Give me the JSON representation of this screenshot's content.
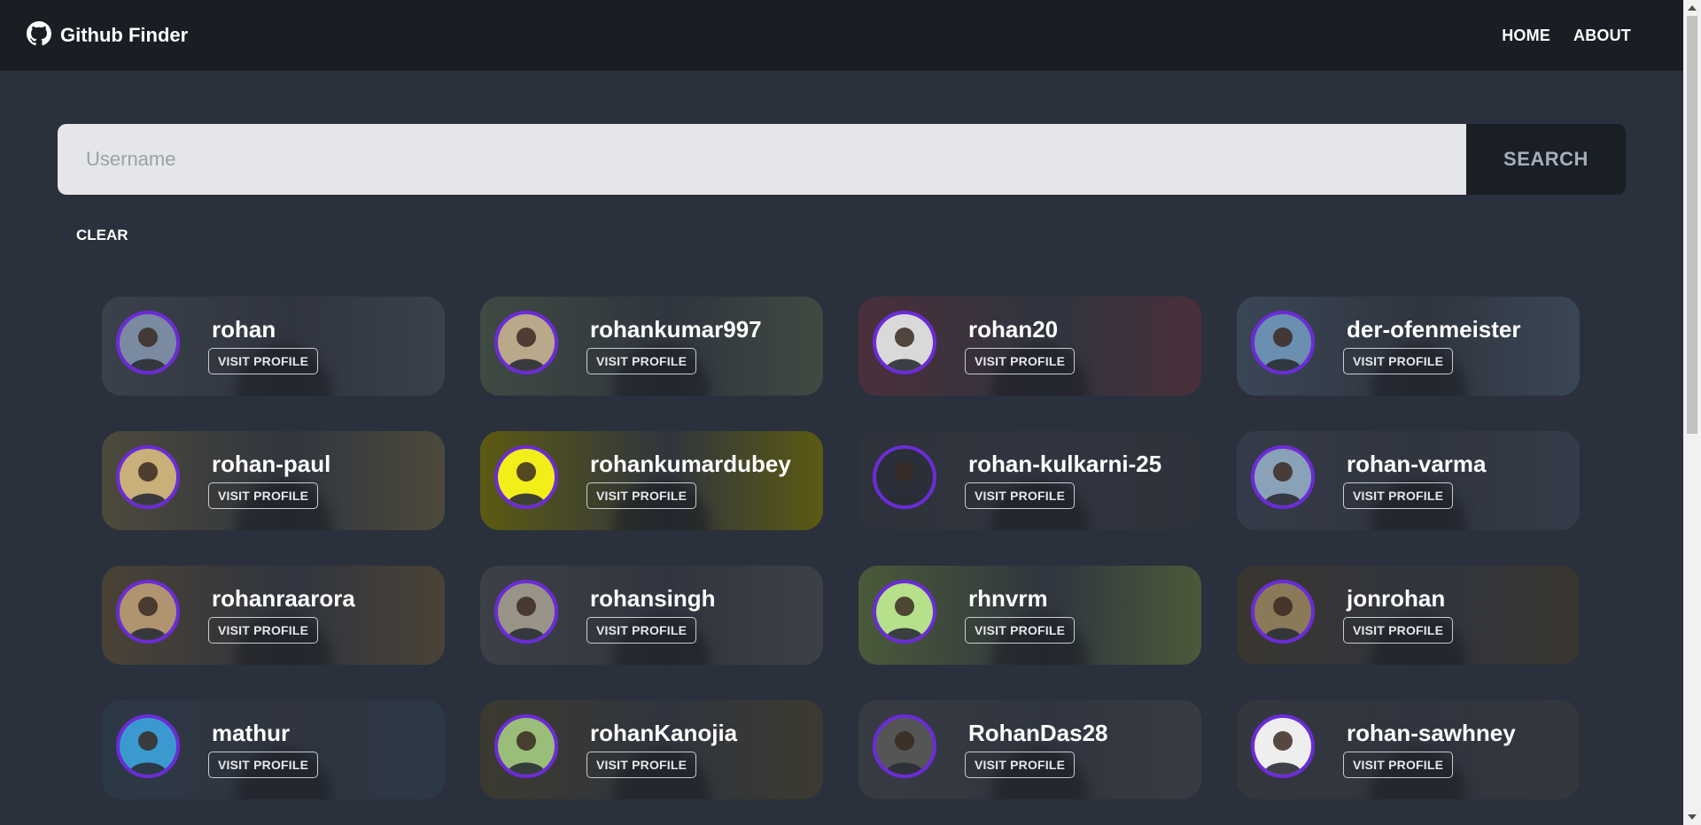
{
  "navbar": {
    "brand_icon": "github-icon",
    "brand_title": "Github Finder",
    "links": [
      "HOME",
      "ABOUT"
    ]
  },
  "search": {
    "placeholder": "Username",
    "button_label": "SEARCH",
    "clear_label": "CLEAR"
  },
  "users": [
    {
      "login": "rohan",
      "action": "VISIT PROFILE",
      "tone": "#3b414c",
      "avatar_bg": "#7a8aa0"
    },
    {
      "login": "rohankumar997",
      "action": "VISIT PROFILE",
      "tone": "#3f4a42",
      "avatar_bg": "#b9a98a"
    },
    {
      "login": "rohan20",
      "action": "VISIT PROFILE",
      "tone": "#4a2f3c",
      "avatar_bg": "#d9d9d9"
    },
    {
      "login": "der-ofenmeister",
      "action": "VISIT PROFILE",
      "tone": "#3a4656",
      "avatar_bg": "#6a8fb0"
    },
    {
      "login": "rohan-paul",
      "action": "VISIT PROFILE",
      "tone": "#4d4a3c",
      "avatar_bg": "#c9b07a"
    },
    {
      "login": "rohankumardubey",
      "action": "VISIT PROFILE",
      "tone": "#5c5a12",
      "avatar_bg": "#f2ee1a"
    },
    {
      "login": "rohan-kulkarni-25",
      "action": "VISIT PROFILE",
      "tone": "#2e323b",
      "avatar_bg": "#2a2f3a"
    },
    {
      "login": "rohan-varma",
      "action": "VISIT PROFILE",
      "tone": "#353b48",
      "avatar_bg": "#8aa2b8"
    },
    {
      "login": "rohanraarora",
      "action": "VISIT PROFILE",
      "tone": "#4a4236",
      "avatar_bg": "#b09470"
    },
    {
      "login": "rohansingh",
      "action": "VISIT PROFILE",
      "tone": "#3d4046",
      "avatar_bg": "#9a9488"
    },
    {
      "login": "rhnvrm",
      "action": "VISIT PROFILE",
      "tone": "#4a5a3a",
      "avatar_bg": "#b6e08a"
    },
    {
      "login": "jonrohan",
      "action": "VISIT PROFILE",
      "tone": "#3a3630",
      "avatar_bg": "#8a7a5a"
    },
    {
      "login": "mathur",
      "action": "VISIT PROFILE",
      "tone": "#2d3846",
      "avatar_bg": "#3a9ad0"
    },
    {
      "login": "rohanKanojia",
      "action": "VISIT PROFILE",
      "tone": "#3c3a30",
      "avatar_bg": "#9abd7a"
    },
    {
      "login": "RohanDas28",
      "action": "VISIT PROFILE",
      "tone": "#383b42",
      "avatar_bg": "#555555"
    },
    {
      "login": "rohan-sawhney",
      "action": "VISIT PROFILE",
      "tone": "#34373d",
      "avatar_bg": "#eeeeee"
    }
  ],
  "colors": {
    "page_bg": "#2a303c",
    "navbar_bg": "#191d24",
    "avatar_ring": "#6c2bd9",
    "search_input_bg": "#e5e6e9",
    "search_button_bg": "#1a1e25"
  }
}
